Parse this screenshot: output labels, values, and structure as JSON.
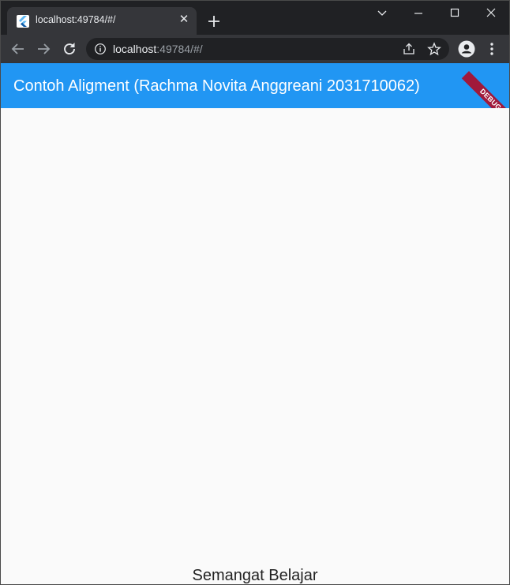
{
  "browser": {
    "tab": {
      "title": "localhost:49784/#/",
      "close_glyph": "✕"
    },
    "address_bar": {
      "host": "localhost",
      "rest": ":49784/#/"
    },
    "icons": {
      "favicon": "flutter-icon",
      "new_tab": "plus-icon",
      "tab_search": "chevron-down-icon",
      "minimize": "minimize-icon",
      "maximize": "maximize-icon",
      "close": "close-icon",
      "back": "arrow-left-icon",
      "forward": "arrow-right-icon",
      "reload": "reload-icon",
      "site_info": "info-icon",
      "share": "share-icon",
      "bookmark": "star-icon",
      "profile": "profile-icon",
      "menu": "kebab-menu-icon"
    }
  },
  "app": {
    "appbar_title": "Contoh Aligment (Rachma Novita Anggreani 2031710062)",
    "debug_banner": "DEBUG",
    "body_text": "Semangat Belajar"
  },
  "colors": {
    "appbar": "#2196f3",
    "background": "#fafafa",
    "debug_banner": "#a0193b",
    "browser_chrome": "#202124",
    "toolbar": "#35363a"
  }
}
